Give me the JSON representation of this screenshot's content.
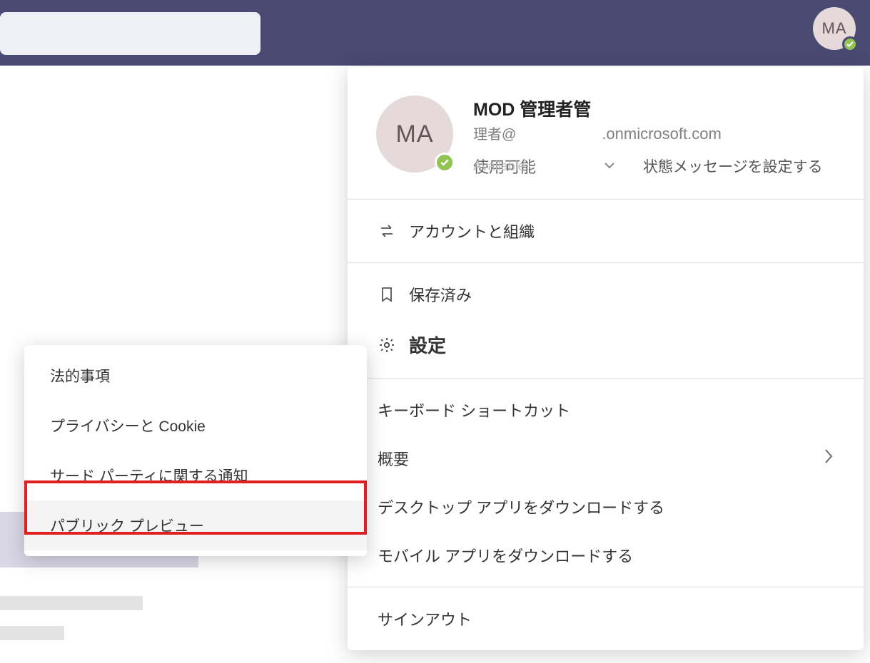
{
  "header": {
    "avatar_initials": "MA"
  },
  "profile": {
    "avatar_initials": "MA",
    "name": "MOD 管理者管",
    "email_prefix": "理者@",
    "email_domain": ".onmicrosoft.com",
    "status_available": "使用可能",
    "status_available_en": "Available",
    "set_status_message": "状態メッセージを設定する"
  },
  "menu": {
    "accounts_orgs": "アカウントと組織",
    "saved": "保存済み",
    "settings": "設定",
    "keyboard_shortcuts": "キーボード ショートカット",
    "about": "概要",
    "download_desktop": "デスクトップ アプリをダウンロードする",
    "download_mobile": "モバイル アプリをダウンロードする",
    "sign_out": "サインアウト"
  },
  "about_submenu": {
    "legal": "法的事項",
    "privacy_cookies": "プライバシーと Cookie",
    "third_party": "サード パーティに関する通知",
    "public_preview": "パブリック プレビュー"
  }
}
